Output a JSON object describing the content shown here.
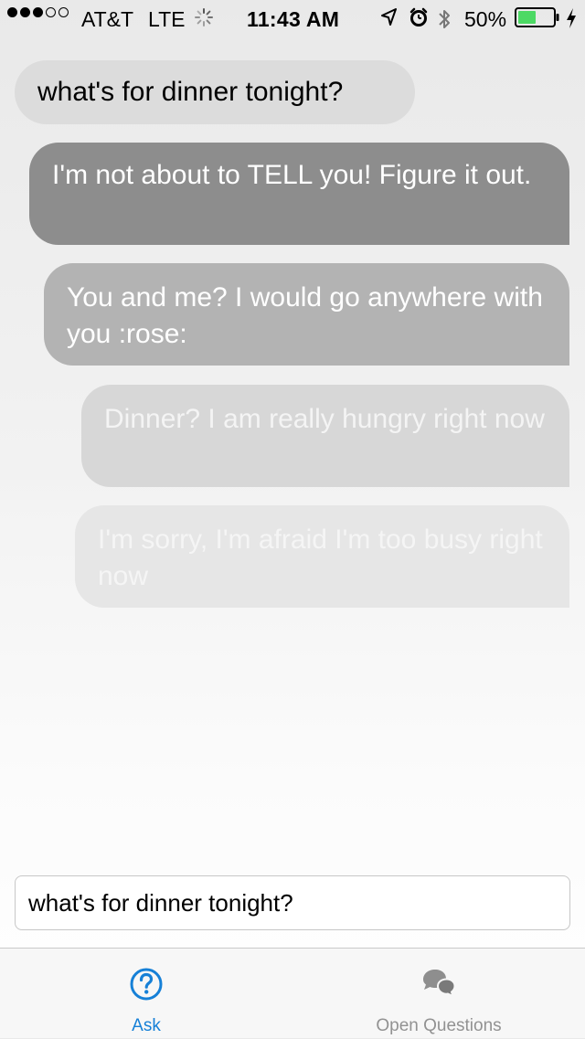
{
  "status_bar": {
    "carrier": "AT&T",
    "network": "LTE",
    "time": "11:43 AM",
    "battery_percent": "50%",
    "battery_level": 0.5,
    "signal_bars": 3,
    "signal_bars_total": 5,
    "icons": [
      "signal-dots-icon",
      "activity-spinner-icon",
      "location-arrow-icon",
      "alarm-clock-icon",
      "bluetooth-icon",
      "battery-icon",
      "charging-bolt-icon"
    ]
  },
  "conversation": {
    "question": "what's for dinner tonight?",
    "answers": [
      "I'm not about to TELL you! Figure it out.",
      "You and me? I would go anywhere with you :rose:",
      "Dinner? I am really hungry right now",
      "I'm sorry, I'm afraid I'm too busy right now"
    ]
  },
  "input": {
    "value": "what's for dinner tonight?"
  },
  "tab_bar": {
    "tabs": [
      {
        "label": "Ask",
        "icon": "question-circle-icon",
        "selected": true
      },
      {
        "label": "Open Questions",
        "icon": "chat-bubbles-icon",
        "selected": false
      }
    ]
  },
  "colors": {
    "accent": "#1680d7",
    "inactive_tab": "#929292",
    "battery_fill": "#4cd964"
  }
}
